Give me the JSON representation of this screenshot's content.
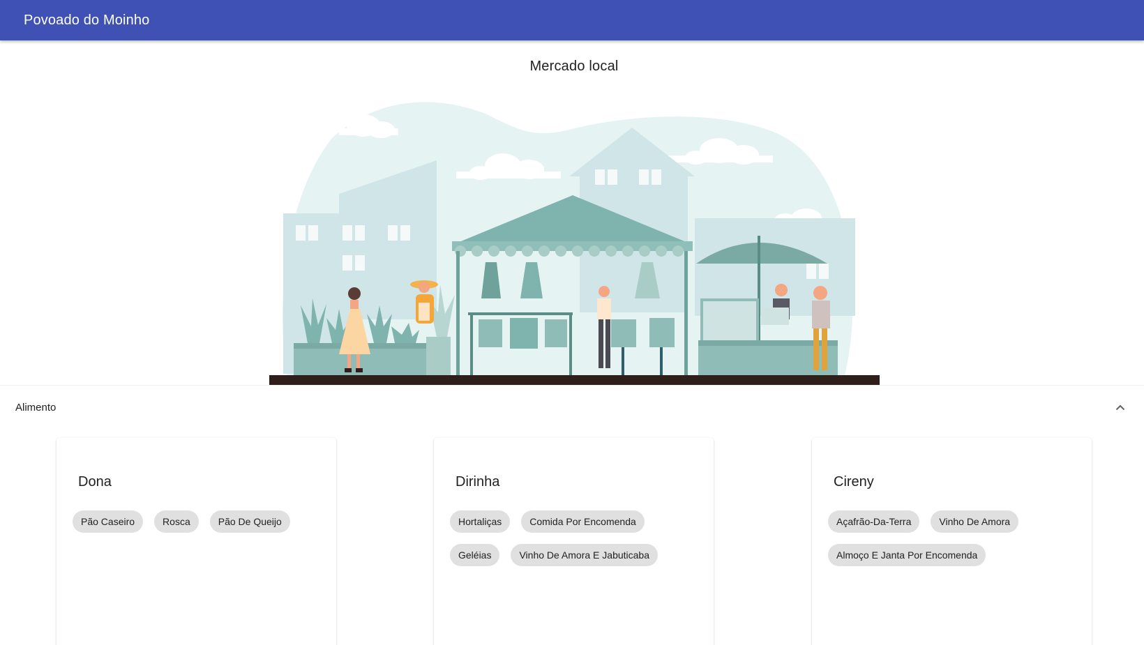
{
  "app": {
    "title": "Povoado do Moinho",
    "brand_color": "#3f51b5"
  },
  "page": {
    "title": "Mercado local",
    "illustration": "market-stalls-illustration"
  },
  "section": {
    "label": "Alimento",
    "expanded": true,
    "toggle_icon": "chevron-up-icon"
  },
  "vendors": [
    {
      "name": "Dona",
      "products": [
        "Pão Caseiro",
        "Rosca",
        "Pão De Queijo"
      ]
    },
    {
      "name": "Dirinha",
      "products": [
        "Hortaliças",
        "Comida Por Encomenda",
        "Geléias",
        "Vinho De Amora E Jabuticaba"
      ]
    },
    {
      "name": "Cireny",
      "products": [
        "Açafrão-Da-Terra",
        "Vinho De Amora",
        "Almoço E Janta Por Encomenda"
      ]
    }
  ]
}
